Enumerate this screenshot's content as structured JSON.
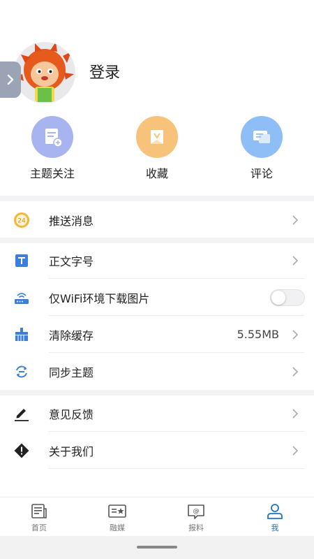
{
  "profile": {
    "login_label": "登录"
  },
  "quick_actions": [
    {
      "label": "主题关注",
      "icon": "subscribe-doc-icon",
      "color": "#a8b4f0"
    },
    {
      "label": "收藏",
      "icon": "bookmark-icon",
      "color": "#f7c27a"
    },
    {
      "label": "评论",
      "icon": "comment-icon",
      "color": "#8fbdf5"
    }
  ],
  "menu": {
    "push": {
      "label": "推送消息",
      "icon": "push-24-icon"
    },
    "font_size": {
      "label": "正文字号",
      "icon": "text-size-icon"
    },
    "wifi_images": {
      "label": "仅WiFi环境下载图片",
      "icon": "wifi-router-icon",
      "enabled": false
    },
    "clear_cache": {
      "label": "清除缓存",
      "value": "5.55MB",
      "icon": "broom-icon"
    },
    "sync_topics": {
      "label": "同步主题",
      "icon": "sync-icon"
    },
    "feedback": {
      "label": "意见反馈",
      "icon": "pen-icon"
    },
    "about": {
      "label": "关于我们",
      "icon": "info-diamond-icon"
    }
  },
  "tabs": [
    {
      "label": "首页",
      "icon": "news-icon",
      "active": false
    },
    {
      "label": "融媒",
      "icon": "media-icon",
      "active": false
    },
    {
      "label": "报料",
      "icon": "report-icon",
      "active": false
    },
    {
      "label": "我",
      "icon": "user-icon",
      "active": true
    }
  ],
  "colors": {
    "accent": "#1976c8",
    "icon_blue": "#3d7ed8",
    "tab_gray": "#777777"
  }
}
